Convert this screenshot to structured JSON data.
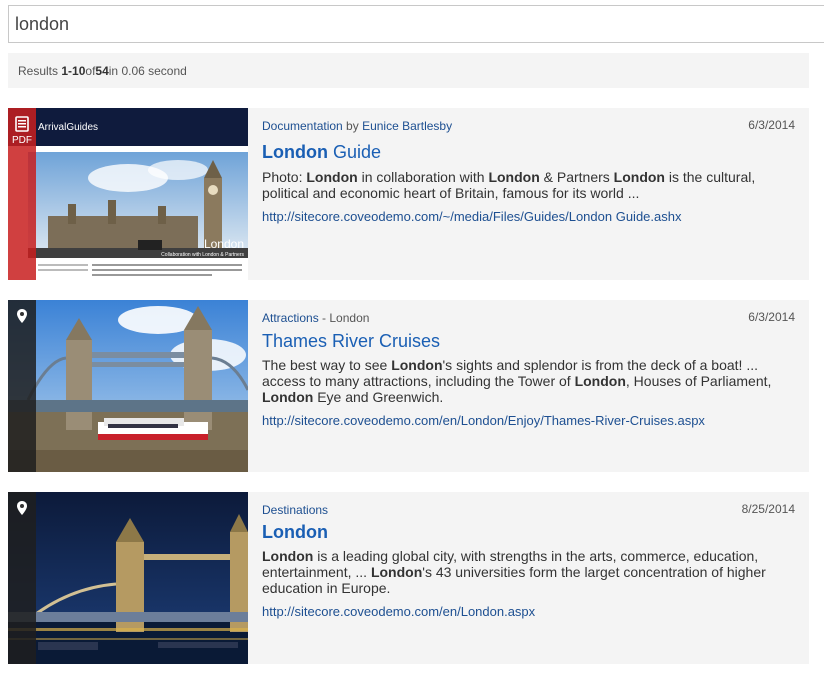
{
  "search": {
    "value": "london"
  },
  "summary": {
    "prefix": "Results ",
    "range": "1-10",
    "of": " of ",
    "total": "54",
    "suffix": " in 0.06 second"
  },
  "results": [
    {
      "type_label": "PDF",
      "type_icon": "pdf-document-icon",
      "meta_source": "Documentation",
      "meta_by": " by ",
      "meta_author": "Eunice Bartlesby",
      "date": "6/3/2014",
      "title_bold": "London",
      "title_rest": " Guide",
      "excerpt": [
        {
          "t": "Photo: ",
          "b": false
        },
        {
          "t": "London",
          "b": true
        },
        {
          "t": " in collaboration with ",
          "b": false
        },
        {
          "t": "London",
          "b": true
        },
        {
          "t": " & Partners ",
          "b": false
        },
        {
          "t": "London",
          "b": true
        },
        {
          "t": " is the cultural, political and economic heart of Britain, famous for its world ...",
          "b": false
        }
      ],
      "uri": "http://sitecore.coveodemo.com/~/media/Files/Guides/London Guide.ashx",
      "thumb": {
        "brand": "ArrivalGuides",
        "caption": "London",
        "subcaption": "Collaboration with London & Partners"
      }
    },
    {
      "type_icon": "map-pin-icon",
      "meta_source": "Attractions",
      "meta_sep": " - London",
      "date": "6/3/2014",
      "title": "Thames River Cruises",
      "excerpt": [
        {
          "t": "The best way to see ",
          "b": false
        },
        {
          "t": "London",
          "b": true
        },
        {
          "t": "'s sights and splendor is from the deck of a boat! ... access to many attractions, including the Tower of ",
          "b": false
        },
        {
          "t": "London",
          "b": true
        },
        {
          "t": ", Houses of Parliament, ",
          "b": false
        },
        {
          "t": "London",
          "b": true
        },
        {
          "t": " Eye and Greenwich.",
          "b": false
        }
      ],
      "uri": "http://sitecore.coveodemo.com/en/London/Enjoy/Thames-River-Cruises.aspx"
    },
    {
      "type_icon": "map-pin-icon",
      "meta_source": "Destinations",
      "date": "8/25/2014",
      "title": "London",
      "excerpt": [
        {
          "t": "London",
          "b": true
        },
        {
          "t": " is a leading global city, with strengths in the arts, commerce, education, entertainment, ... ",
          "b": false
        },
        {
          "t": "London",
          "b": true
        },
        {
          "t": "'s 43 universities form the larget concentration of higher education in Europe.",
          "b": false
        }
      ],
      "uri": "http://sitecore.coveodemo.com/en/London.aspx"
    }
  ],
  "colors": {
    "link": "#1a5fb4",
    "pdf_bar": "#c81e1e",
    "card_bg": "#f4f4f4"
  }
}
